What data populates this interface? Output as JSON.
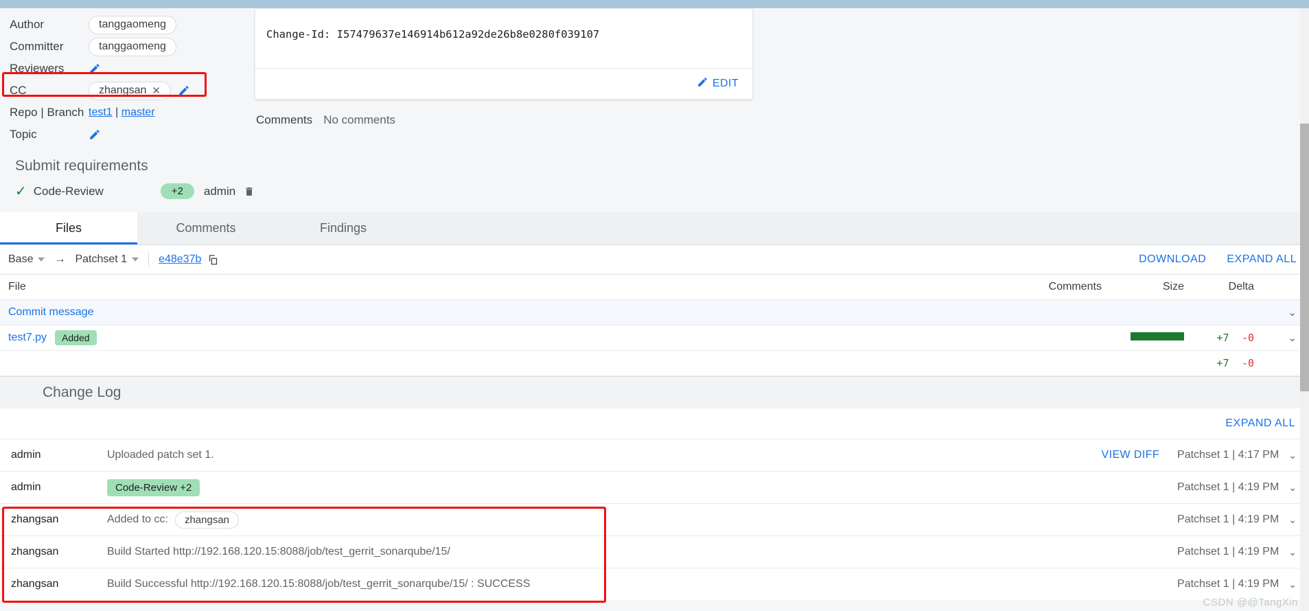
{
  "metadata": {
    "rows": [
      {
        "label": "Author",
        "value": "tanggaomeng"
      },
      {
        "label": "Committer",
        "value": "tanggaomeng"
      },
      {
        "label": "Reviewers",
        "value": ""
      },
      {
        "label": "CC",
        "value": "zhangsan"
      },
      {
        "label": "Repo | Branch",
        "value": ""
      },
      {
        "label": "Topic",
        "value": ""
      }
    ],
    "repo": "test1",
    "branch": "master",
    "repo_separator": "|"
  },
  "commit": {
    "message": "Change-Id: I57479637e146914b612a92de26b8e0280f039107",
    "edit_label": "EDIT",
    "comments_label": "Comments",
    "comments_value": "No comments"
  },
  "submit_requirements": {
    "title": "Submit requirements",
    "name": "Code-Review",
    "vote": "+2",
    "user": "admin"
  },
  "tabs": [
    {
      "label": "Files",
      "active": true
    },
    {
      "label": "Comments",
      "active": false
    },
    {
      "label": "Findings",
      "active": false
    }
  ],
  "patchset_bar": {
    "base": "Base",
    "arrow": "→",
    "patchset": "Patchset 1",
    "commit_hash": "e48e37b",
    "download": "DOWNLOAD",
    "expand_all": "EXPAND ALL"
  },
  "file_table": {
    "headers": {
      "file": "File",
      "comments": "Comments",
      "size": "Size",
      "delta": "Delta"
    },
    "rows": [
      {
        "name": "Commit message",
        "badge": "",
        "added": "",
        "removed": "",
        "has_bar": false
      },
      {
        "name": "test7.py",
        "badge": "Added",
        "added": "+7",
        "removed": "-0",
        "has_bar": true
      }
    ],
    "total": {
      "added": "+7",
      "removed": "-0"
    }
  },
  "change_log": {
    "title": "Change Log",
    "expand_all": "EXPAND ALL",
    "entries": [
      {
        "user": "admin",
        "message": "Uploaded patch set 1.",
        "type": "text",
        "view_diff": "VIEW DIFF",
        "patchset": "Patchset 1 | 4:17 PM"
      },
      {
        "user": "admin",
        "message": "Code-Review +2",
        "type": "pill",
        "view_diff": "",
        "patchset": "Patchset 1 | 4:19 PM"
      },
      {
        "user": "zhangsan",
        "message": "Added to cc:",
        "chip": "zhangsan",
        "type": "cc",
        "view_diff": "",
        "patchset": "Patchset 1 | 4:19 PM"
      },
      {
        "user": "zhangsan",
        "message": "Build Started http://192.168.120.15:8088/job/test_gerrit_sonarqube/15/",
        "type": "text",
        "view_diff": "",
        "patchset": "Patchset 1 | 4:19 PM"
      },
      {
        "user": "zhangsan",
        "message": "Build Successful http://192.168.120.15:8088/job/test_gerrit_sonarqube/15/ : SUCCESS",
        "type": "text",
        "view_diff": "",
        "patchset": "Patchset 1 | 4:19 PM"
      }
    ]
  },
  "watermark": "CSDN @@TangXin",
  "colors": {
    "accent": "#1a73e8",
    "green_pill": "#a0dfb5",
    "added_green": "#188038",
    "removed_red": "#d93025",
    "highlight_red": "#f40f0f",
    "topbar_blue": "#a8c5da"
  }
}
